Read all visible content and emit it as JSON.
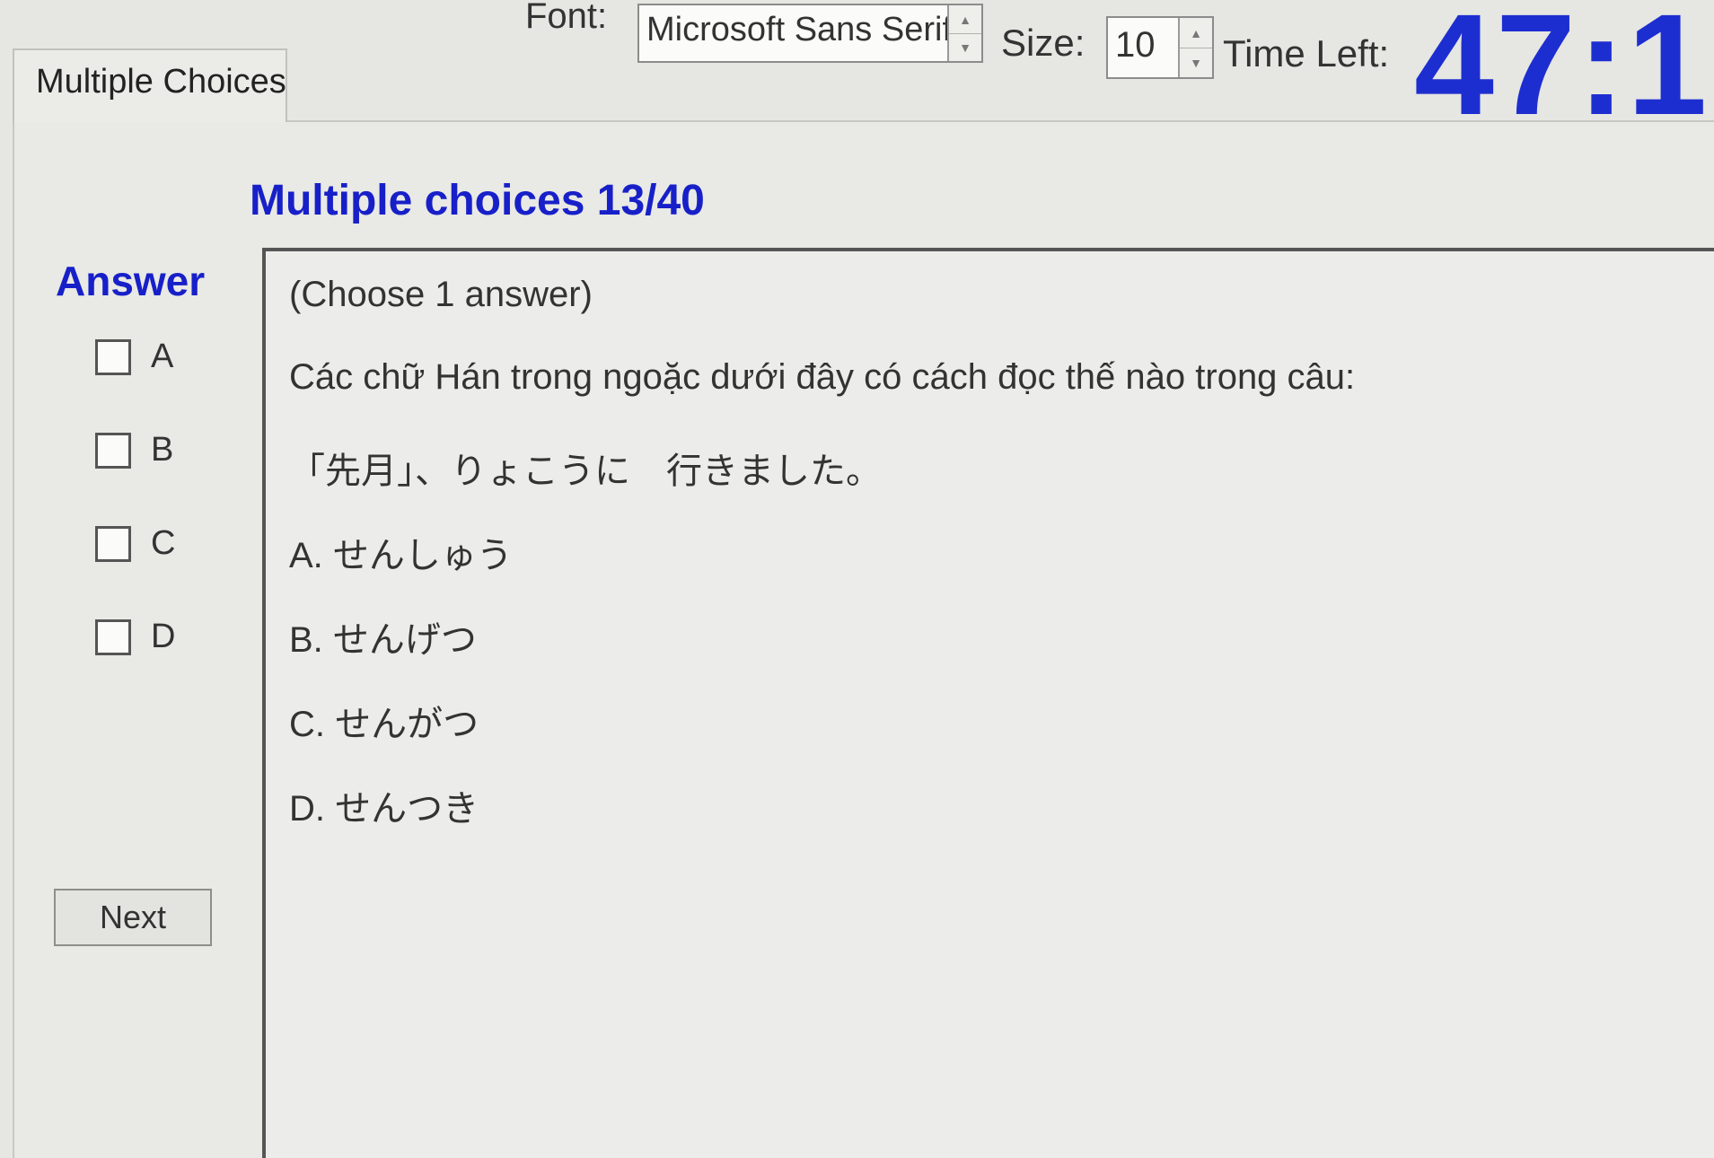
{
  "toolbar": {
    "font_label": "Font:",
    "font_value": "Microsoft Sans Serif",
    "size_label": "Size:",
    "size_value": "10",
    "time_left_label": "Time Left:",
    "timer": "47:1"
  },
  "tab": {
    "label": "Multiple Choices"
  },
  "question": {
    "heading": "Multiple choices 13/40",
    "instruction": "(Choose 1 answer)",
    "prompt": "Các chữ Hán trong ngoặc dưới đây có cách đọc thế nào trong câu:",
    "sentence": "「先月」、りょこうに　行きました。",
    "options": [
      "A.  せんしゅう",
      "B.  せんげつ",
      "C.  せんがつ",
      "D.  せんつき"
    ]
  },
  "answer": {
    "heading": "Answer",
    "choices": [
      "A",
      "B",
      "C",
      "D"
    ]
  },
  "next_label": "Next",
  "colors": {
    "accent_blue": "#1720c8",
    "background": "#e6e6e2"
  }
}
